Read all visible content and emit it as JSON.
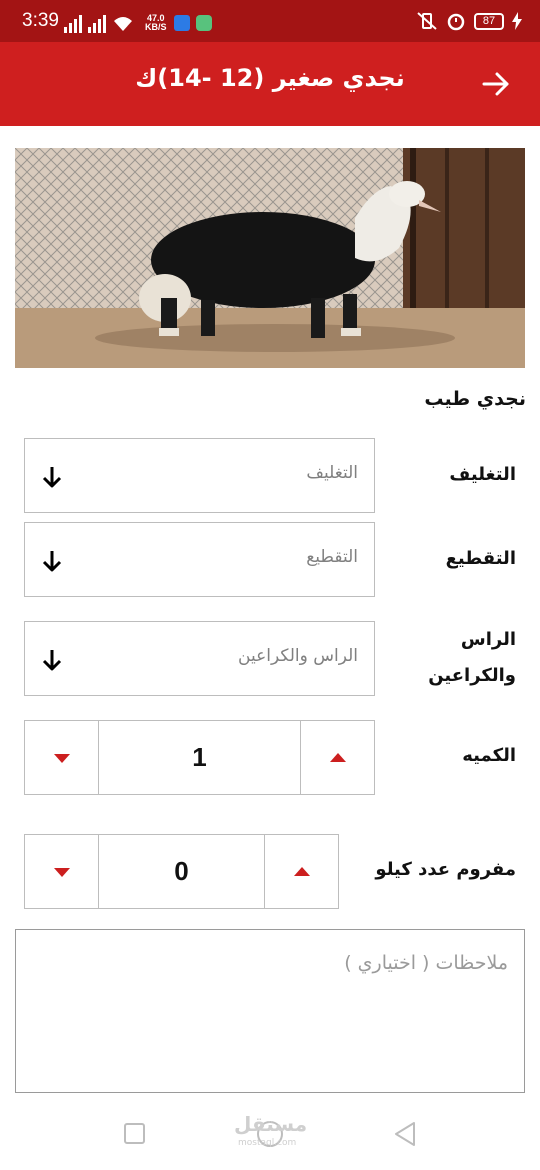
{
  "status_bar": {
    "time": "3:39",
    "net_speed_value": "47.0",
    "net_speed_unit": "KB/S",
    "battery": "87"
  },
  "header": {
    "title": "نجدي صغير (12 -14)ك",
    "back_icon": "arrow-right-icon",
    "background_color": "#cf1f1f"
  },
  "product": {
    "image": "sheep-photo",
    "name": "نجدي طيب"
  },
  "options": {
    "packaging": {
      "label": "التغليف",
      "value": "التغليف"
    },
    "cutting": {
      "label": "التقطيع",
      "value": "التقطيع"
    },
    "head_trotters": {
      "label": "الراس والكراعين",
      "value": "الراس والكراعين"
    }
  },
  "quantity": {
    "label": "الكميه",
    "value": "1"
  },
  "minced": {
    "label": "مفروم عدد كيلو",
    "value": "0"
  },
  "notes": {
    "placeholder": "ملاحظات ( اختياري )"
  },
  "watermark": {
    "text": "مستقل",
    "sub": "mostaql.com"
  },
  "accent_color": "#cc1f1f"
}
